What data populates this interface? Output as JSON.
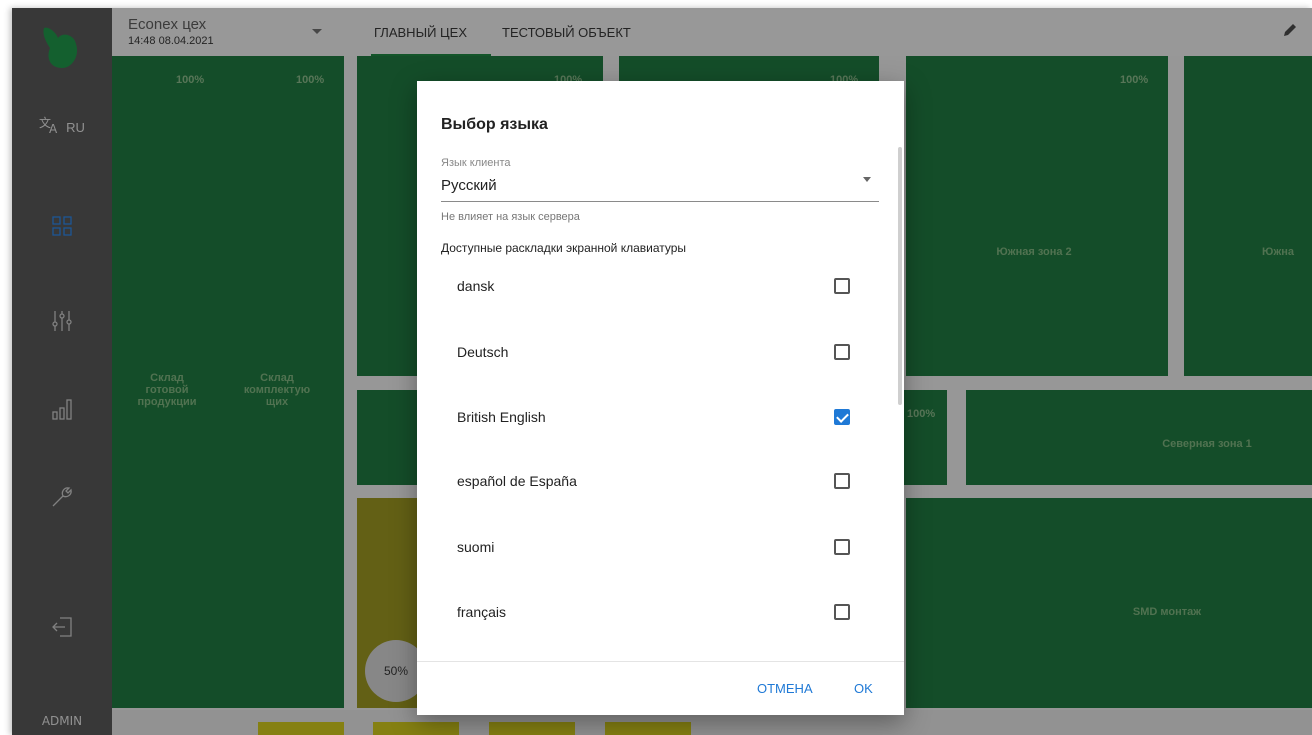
{
  "header": {
    "project_title": "Econex цех",
    "project_time": "14:48 08.04.2021",
    "tabs": [
      {
        "label": "ГЛАВНЫЙ ЦЕХ"
      },
      {
        "label": "ТЕСТОВЫЙ ОБЪЕКТ"
      }
    ]
  },
  "sidebar": {
    "language": "RU",
    "user": "ADMIN"
  },
  "dashboard": {
    "zones": [
      {
        "name": "Склад\nготовой\nпродукции",
        "pct": "100%"
      },
      {
        "name": "Склад\nкомплектую\nщих",
        "pct": "100%"
      },
      {
        "name": "",
        "pct": "100%"
      },
      {
        "name": "",
        "pct": "100%"
      },
      {
        "name": "Южная зона 2",
        "pct": "100%"
      },
      {
        "name": "Южна",
        "pct": ""
      },
      {
        "name": "",
        "pct": "100%"
      },
      {
        "name": "Северная зона 1",
        "pct": ""
      },
      {
        "name": "SMD монтаж",
        "pct": ""
      }
    ],
    "circle_value": "50%"
  },
  "dialog": {
    "title": "Выбор языка",
    "client_lang_label": "Язык клиента",
    "client_lang_value": "Русский",
    "hint": "Не влияет на язык сервера",
    "layouts_label": "Доступные раскладки экранной клавиатуры",
    "languages": [
      {
        "name": "dansk",
        "checked": false
      },
      {
        "name": "Deutsch",
        "checked": false
      },
      {
        "name": "British English",
        "checked": true
      },
      {
        "name": "español de España",
        "checked": false
      },
      {
        "name": "suomi",
        "checked": false
      },
      {
        "name": "français",
        "checked": false
      }
    ],
    "cancel_label": "ОТМЕНА",
    "ok_label": "OK"
  },
  "colors": {
    "zone_green": "#1e6f3b",
    "zone_yellow": "#8f8a1f",
    "accent_blue": "#1f79d6",
    "sidebar_bg": "#515151"
  }
}
